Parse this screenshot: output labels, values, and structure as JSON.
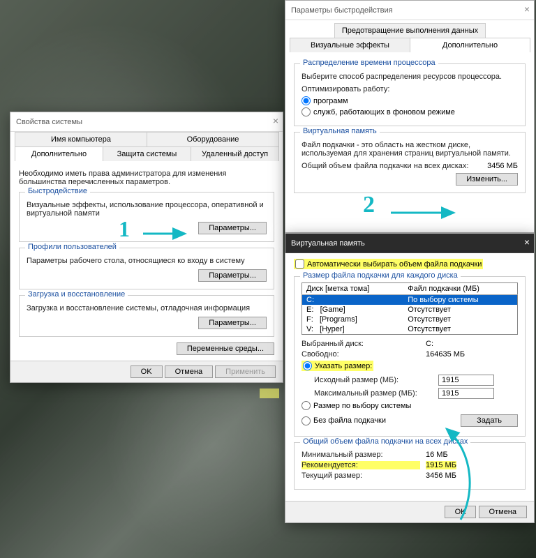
{
  "sysProps": {
    "title": "Свойства системы",
    "tabsTop": [
      "Имя компьютера",
      "Оборудование"
    ],
    "tabsBottom": [
      "Дополнительно",
      "Защита системы",
      "Удаленный доступ"
    ],
    "adminNote": "Необходимо иметь права администратора для изменения большинства перечисленных параметров.",
    "perf": {
      "legend": "Быстродействие",
      "text": "Визуальные эффекты, использование процессора, оперативной и виртуальной памяти",
      "btn": "Параметры..."
    },
    "profiles": {
      "legend": "Профили пользователей",
      "text": "Параметры рабочего стола, относящиеся ко входу в систему",
      "btn": "Параметры..."
    },
    "startup": {
      "legend": "Загрузка и восстановление",
      "text": "Загрузка и восстановление системы, отладочная информация",
      "btn": "Параметры..."
    },
    "envBtn": "Переменные среды...",
    "ok": "OK",
    "cancel": "Отмена",
    "apply": "Применить"
  },
  "perfOpts": {
    "title": "Параметры быстродействия",
    "tabTop": "Предотвращение выполнения данных",
    "tabs": [
      "Визуальные эффекты",
      "Дополнительно"
    ],
    "sched": {
      "legend": "Распределение времени процессора",
      "text": "Выберите способ распределения ресурсов процессора.",
      "opt": "Оптимизировать работу:",
      "r1": "программ",
      "r2": "служб, работающих в фоновом режиме"
    },
    "vmem": {
      "legend": "Виртуальная память",
      "text": "Файл подкачки - это область на жестком диске, используемая для хранения страниц виртуальной памяти.",
      "totLabel": "Общий объем файла подкачки на всех дисках:",
      "totVal": "3456 МБ",
      "btn": "Изменить..."
    }
  },
  "vmDlg": {
    "title": "Виртуальная память",
    "auto": "Автоматически выбирать объем файла подкачки",
    "sizeEach": "Размер файла подкачки для каждого диска",
    "hdr1": "Диск [метка тома]",
    "hdr2": "Файл подкачки (МБ)",
    "drives": [
      {
        "d": "C:",
        "label": "",
        "pf": "По выбору системы",
        "sel": true
      },
      {
        "d": "E:",
        "label": "[Game]",
        "pf": "Отсутствует"
      },
      {
        "d": "F:",
        "label": "[Programs]",
        "pf": "Отсутствует"
      },
      {
        "d": "V:",
        "label": "[Hyper]",
        "pf": "Отсутствует"
      }
    ],
    "selDrive": "Выбранный диск:",
    "selDriveVal": "C:",
    "free": "Свободно:",
    "freeVal": "164635 МБ",
    "custom": "Указать размер:",
    "init": "Исходный размер (МБ):",
    "initVal": "1915",
    "max": "Максимальный размер (МБ):",
    "maxVal": "1915",
    "sys": "Размер по выбору системы",
    "none": "Без файла подкачки",
    "set": "Задать",
    "totalLegend": "Общий объем файла подкачки на всех дисках",
    "min": "Минимальный размер:",
    "minVal": "16 МБ",
    "rec": "Рекомендуется:",
    "recVal": "1915 МБ",
    "cur": "Текущий размер:",
    "curVal": "3456 МБ",
    "ok": "OK",
    "cancel": "Отмена"
  },
  "anno": {
    "one": "1",
    "two": "2"
  }
}
